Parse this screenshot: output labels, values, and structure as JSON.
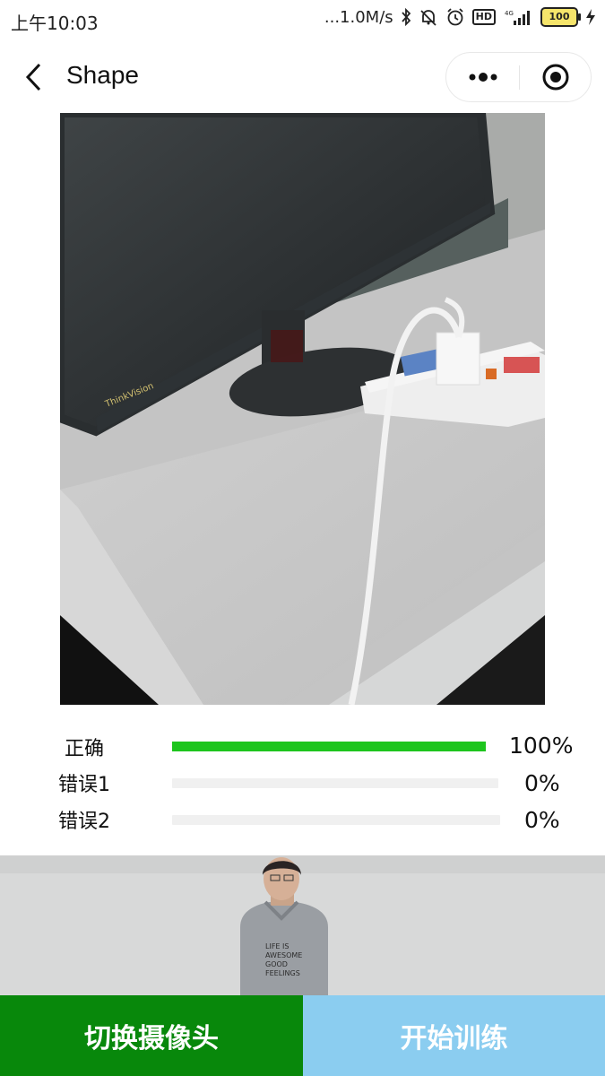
{
  "status_bar": {
    "time": "上午10:03",
    "net_speed": "...1.0M/s",
    "hd": "HD",
    "signal_label": "4G",
    "battery": "100",
    "icons": [
      "bluetooth-icon",
      "mute-icon",
      "alarm-icon",
      "hd-icon",
      "signal-icon",
      "battery-icon",
      "charging-icon"
    ]
  },
  "navbar": {
    "title": "Shape",
    "icons": [
      "back-arrow-icon",
      "more-dots-icon",
      "target-close-icon"
    ]
  },
  "results": [
    {
      "label": "正确",
      "value": "100%",
      "fraction": 1.0,
      "color": "#1dc51d"
    },
    {
      "label": "错误1",
      "value": "0%",
      "fraction": 0.0,
      "color": "#1dc51d"
    },
    {
      "label": "错误2",
      "value": "0%",
      "fraction": 0.0,
      "color": "#1dc51d"
    }
  ],
  "camera_shirt_text": [
    "LIFE IS",
    "AWESOME",
    "GOOD",
    "FEELINGS"
  ],
  "buttons": {
    "switch_camera": "切换摄像头",
    "start_training": "开始训练"
  },
  "colors": {
    "progress": "#1dc51d",
    "switch_button": "#08880b",
    "train_button": "#8bcdf0"
  }
}
